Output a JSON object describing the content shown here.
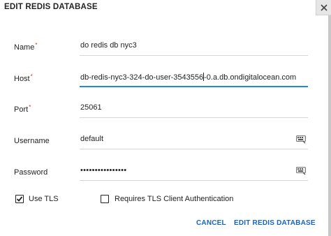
{
  "dialog": {
    "title": "EDIT REDIS DATABASE"
  },
  "fields": {
    "name": {
      "label": "Name",
      "required": "*",
      "value": "do redis db nyc3"
    },
    "host": {
      "label": "Host",
      "required": "*",
      "value_before_caret": "db-redis-nyc3-324-do-user-3543556",
      "value_after_caret": "-0.a.db.ondigitalocean.com"
    },
    "port": {
      "label": "Port",
      "required": "*",
      "value": "25061"
    },
    "username": {
      "label": "Username",
      "value": "default"
    },
    "password": {
      "label": "Password",
      "value": "••••••••••••••••"
    }
  },
  "options": {
    "use_tls": {
      "label": "Use TLS",
      "checked": true
    },
    "tls_client_auth": {
      "label": "Requires TLS Client Authentication",
      "checked": false
    }
  },
  "actions": {
    "cancel_label": "CANCEL",
    "submit_label": "EDIT REDIS DATABASE"
  },
  "colors": {
    "accent": "#1565c0",
    "focus_underline": "#1e88e5",
    "required_marker": "#d32f2f"
  },
  "icons": {
    "close": "close-icon",
    "variable": "variable-picker-icon"
  }
}
